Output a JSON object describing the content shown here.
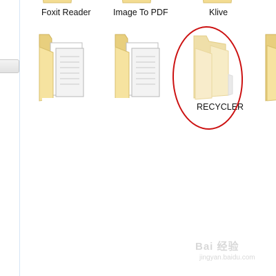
{
  "folders": [
    {
      "name": "Foxit Reader",
      "icon": "folder-icon"
    },
    {
      "name": "Image To PDF",
      "icon": "folder-icon"
    },
    {
      "name": "Klive",
      "icon": "folder-icon"
    },
    {
      "name": "",
      "icon": "folder-with-documents-icon"
    },
    {
      "name": "",
      "icon": "folder-with-documents-icon"
    },
    {
      "name": "RECYCLER",
      "icon": "hidden-folder-icon"
    }
  ],
  "annotation": {
    "color": "#cc1111",
    "shape": "ellipse"
  },
  "watermark": {
    "text": "Bai 经验",
    "url": "jingyan.baidu.com"
  },
  "colors": {
    "folder_front": "#f6e3a0",
    "folder_back": "#e8cf7e",
    "hidden_folder": "#f7ecc6",
    "nav_border": "#d6e5f5"
  }
}
